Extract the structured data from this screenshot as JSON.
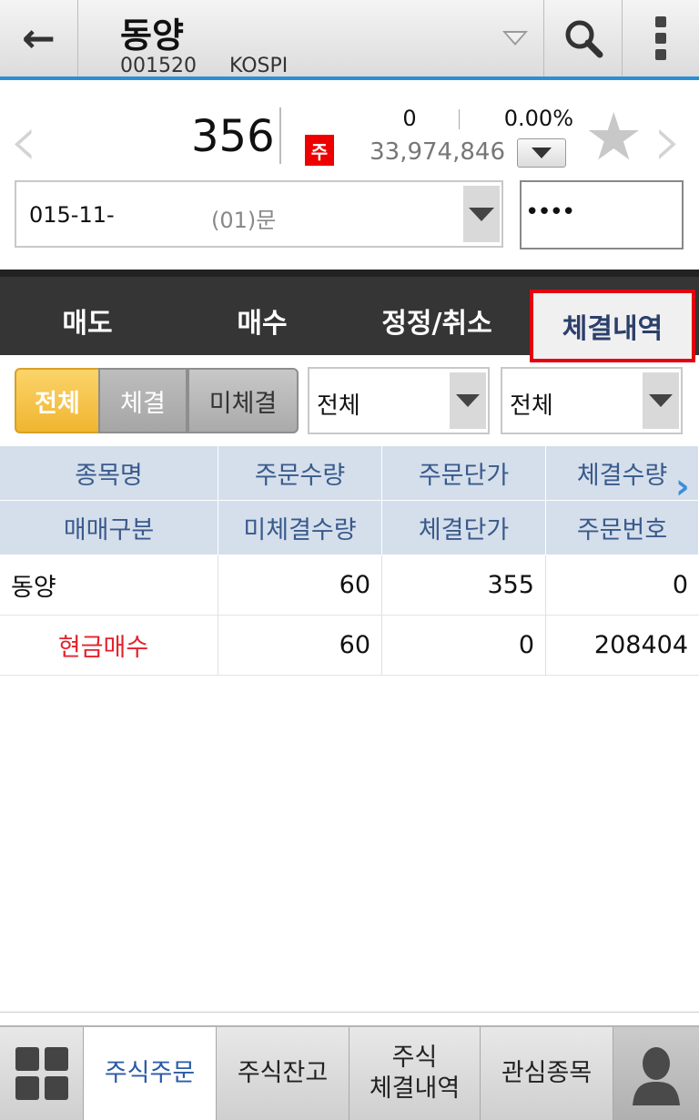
{
  "header": {
    "stock_name": "동양",
    "stock_code": "001520",
    "market": "KOSPI"
  },
  "quote": {
    "price": "356",
    "badge": "주",
    "change": "0",
    "change_pct": "0.00%",
    "volume": "33,974,846"
  },
  "account": {
    "number": "015-11-",
    "type": "(01)문",
    "password": "••••"
  },
  "tabs": [
    "매도",
    "매수",
    "정정/취소",
    "체결내역"
  ],
  "filters": {
    "segments": [
      "전체",
      "체결",
      "미체결"
    ],
    "select1": "전체",
    "select2": "전체"
  },
  "table": {
    "header_row1": [
      "종목명",
      "주문수량",
      "주문단가",
      "체결수량"
    ],
    "header_row2": [
      "매매구분",
      "미체결수량",
      "체결단가",
      "주문번호"
    ],
    "rows": [
      [
        "동양",
        "60",
        "355",
        "0"
      ],
      [
        "현금매수",
        "60",
        "0",
        "208404"
      ]
    ]
  },
  "bottom_nav": {
    "items": [
      "주식주문",
      "주식잔고",
      "주식\n체결내역",
      "관심종목"
    ]
  },
  "colors": {
    "accent_blue": "#2a90d6",
    "highlight_red": "#e3000f",
    "segment_active": "#f0b530",
    "buy_red": "#e3232b"
  }
}
